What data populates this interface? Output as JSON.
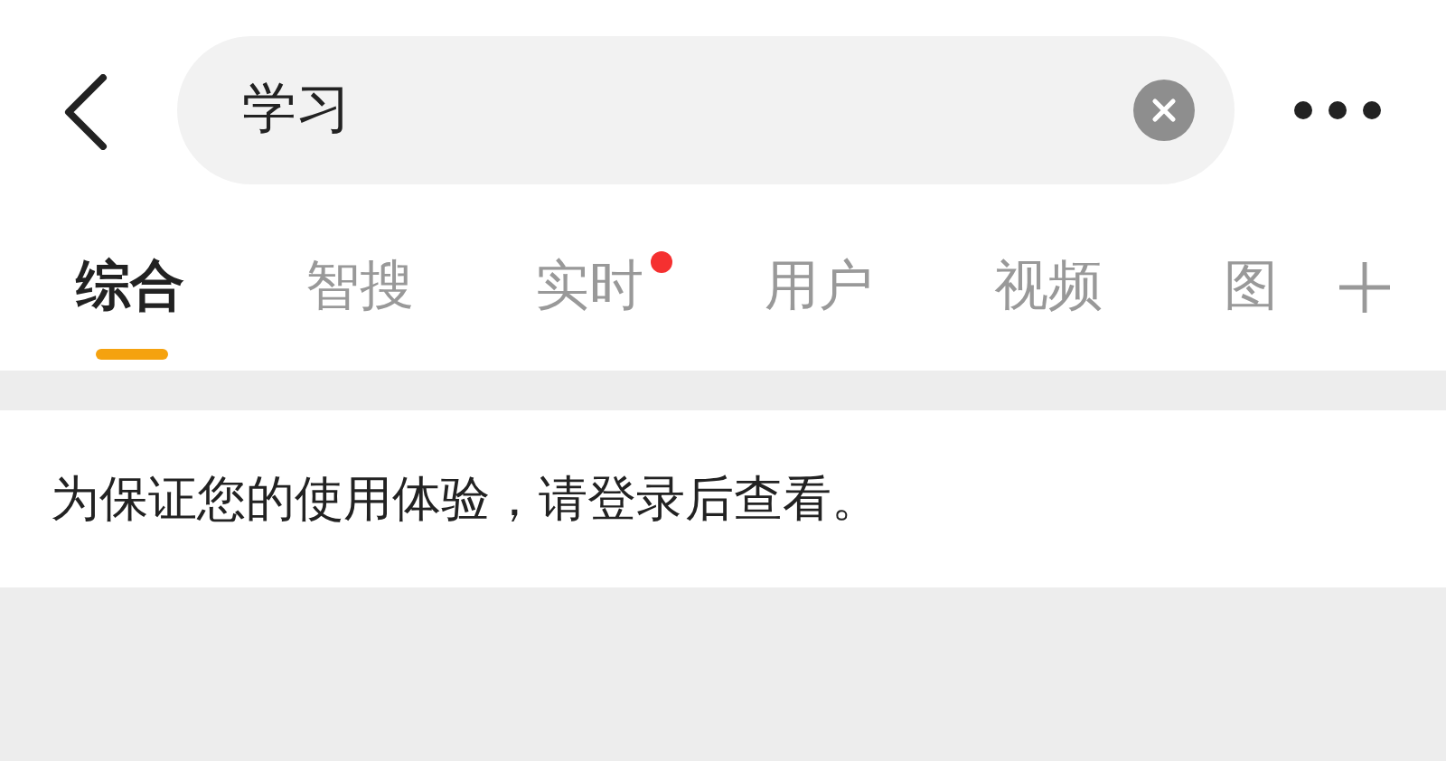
{
  "search": {
    "value": "学习"
  },
  "tabs": [
    {
      "label": "综合",
      "selected": true,
      "dot": false
    },
    {
      "label": "智搜",
      "selected": false,
      "dot": false
    },
    {
      "label": "实时",
      "selected": false,
      "dot": true
    },
    {
      "label": "用户",
      "selected": false,
      "dot": false
    },
    {
      "label": "视频",
      "selected": false,
      "dot": false
    },
    {
      "label": "图",
      "selected": false,
      "dot": false
    }
  ],
  "notice": "为保证您的使用体验，请登录后查看。"
}
